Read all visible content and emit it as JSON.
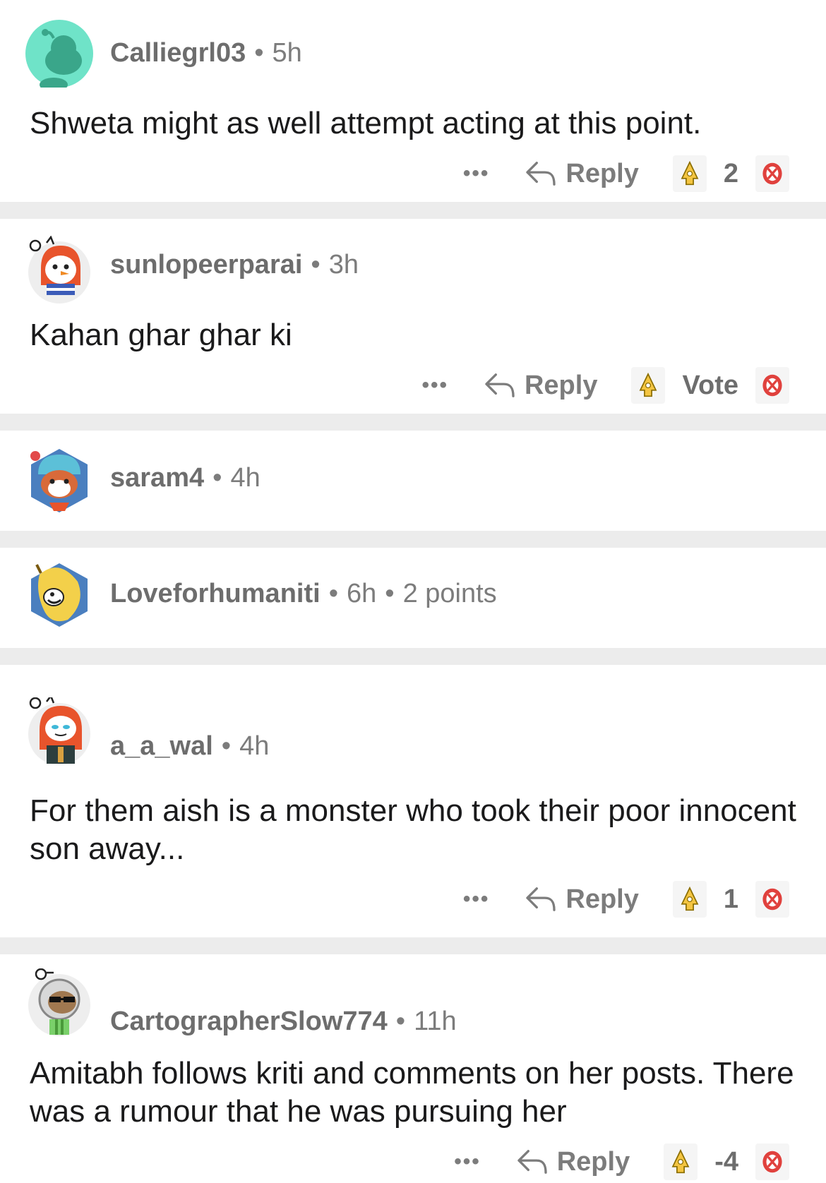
{
  "comments": [
    {
      "username": "Calliegrl03",
      "time": "5h",
      "text": "Shweta might as well attempt acting at this point.",
      "reply_label": "Reply",
      "score": "2",
      "more_label": "•••",
      "avatar_icon": "snoo-default-avatar-icon"
    },
    {
      "username": "sunlopeerparai",
      "time": "3h",
      "text": "Kahan ghar ghar ki",
      "reply_label": "Reply",
      "score": "Vote",
      "more_label": "•••",
      "avatar_icon": "snoo-hooded-snowman-avatar-icon"
    },
    {
      "username": "saram4",
      "time": "4h",
      "avatar_icon": "red-panda-beanie-avatar-icon"
    },
    {
      "username": "Loveforhumaniti",
      "time": "6h",
      "points": "2 points",
      "avatar_icon": "banana-avatar-icon"
    },
    {
      "username": "a_a_wal",
      "time": "4h",
      "text": "For them aish is a monster who took their poor innocent son away...",
      "reply_label": "Reply",
      "score": "1",
      "more_label": "•••",
      "avatar_icon": "snoo-orange-hood-avatar-icon"
    },
    {
      "username": "CartographerSlow774",
      "time": "11h",
      "text": "Amitabh follows kriti and comments on her posts. There was a rumour that he was pursuing her",
      "reply_label": "Reply",
      "score": "-4",
      "more_label": "•••",
      "avatar_icon": "snoo-astronaut-sunglasses-avatar-icon"
    }
  ],
  "colors": {
    "separator": "#ececec",
    "meta_text": "#7c7c7c",
    "body_text": "#1a1a1b",
    "avatar_bg_teal": "#6fe3c8",
    "downvote_red": "#e0413d",
    "award_gold": "#f4c542"
  }
}
